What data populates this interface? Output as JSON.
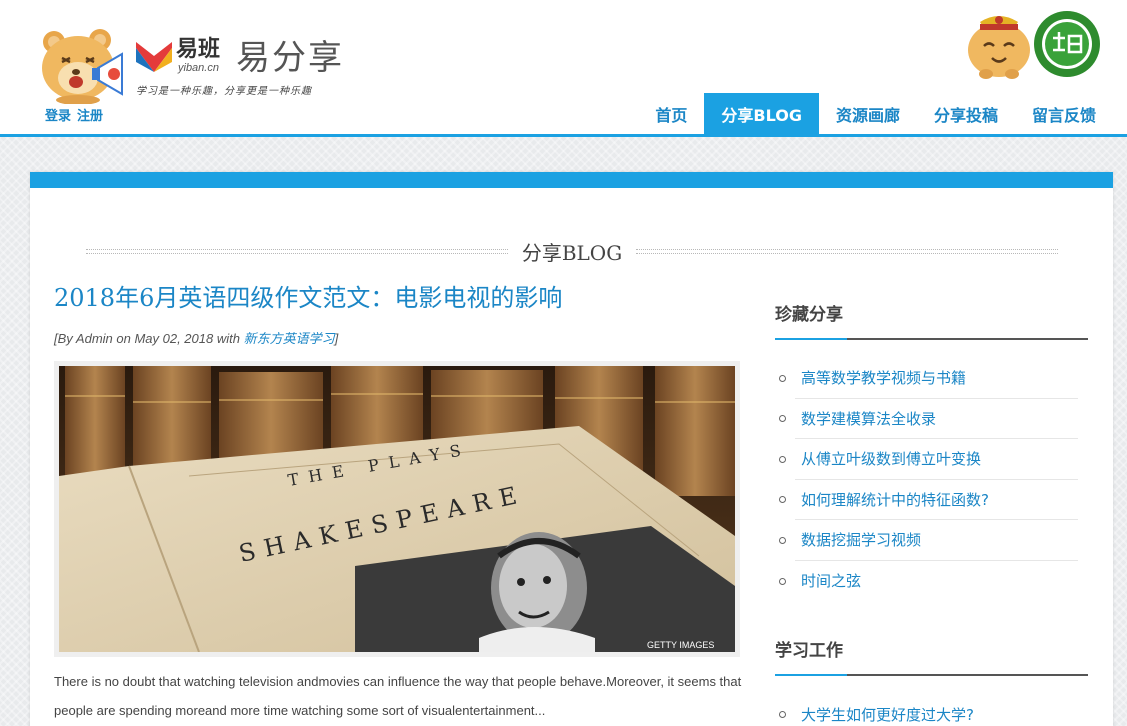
{
  "header": {
    "auth": {
      "login": "登录",
      "register": "注册"
    },
    "brand": {
      "yiban_name": "易班",
      "yiban_domain": "yiban.cn",
      "share_name": "易分享",
      "slogan": "学习是一种乐趣，分享更是一种乐趣"
    },
    "nav": [
      {
        "label": "首页",
        "active": false
      },
      {
        "label": "分享BLOG",
        "active": true
      },
      {
        "label": "资源画廊",
        "active": false
      },
      {
        "label": "分享投稿",
        "active": false
      },
      {
        "label": "留言反馈",
        "active": false
      }
    ]
  },
  "main": {
    "section_title": "分享BLOG",
    "post": {
      "title": "2018年6月英语四级作文范文：电影电视的影响",
      "meta_prefix": "[By Admin on May 02, 2018 with ",
      "meta_category": "新东方英语学习",
      "meta_suffix": "]",
      "image": {
        "book_line1": "THE PLAYS",
        "book_line2": "SHAKESPEARE",
        "watermark": "GETTY IMAGES"
      },
      "excerpt": "There is no doubt that watching television andmovies can influence the way that people behave.Moreover, it seems that people are spending moreand more time watching some sort of visualentertainment..."
    }
  },
  "sidebar": {
    "widgets": [
      {
        "title": "珍藏分享",
        "items": [
          "高等数学教学视频与书籍",
          "数学建模算法全收录",
          "从傅立叶级数到傅立叶变换",
          "如何理解统计中的特征函数?",
          "数据挖掘学习视频",
          "时间之弦"
        ]
      },
      {
        "title": "学习工作",
        "items": [
          "大学生如何更好度过大学?"
        ]
      }
    ]
  },
  "colors": {
    "accent": "#1ba1e2",
    "link": "#1b86c6",
    "text": "#444444"
  }
}
